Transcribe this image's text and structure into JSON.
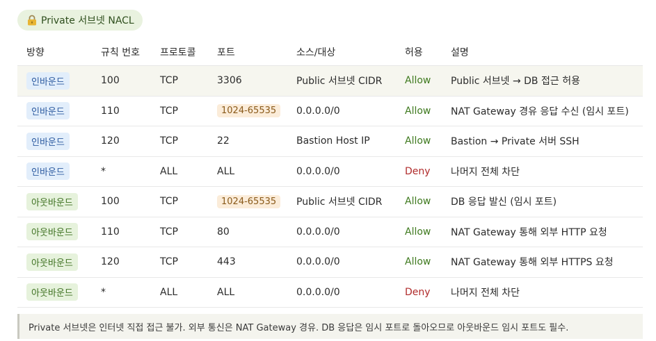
{
  "title": "Private 서브넷 NACL",
  "columns": [
    "방향",
    "규칙 번호",
    "프로토콜",
    "포트",
    "소스/대상",
    "허용",
    "설명"
  ],
  "rows": [
    {
      "dir": "인바운드",
      "dir_type": "in",
      "rule": "100",
      "proto": "TCP",
      "port": "3306",
      "port_pill": false,
      "source": "Public 서브넷 CIDR",
      "action": "Allow",
      "desc": "Public 서브넷 → DB 접근 허용"
    },
    {
      "dir": "인바운드",
      "dir_type": "in",
      "rule": "110",
      "proto": "TCP",
      "port": "1024-65535",
      "port_pill": true,
      "source": "0.0.0.0/0",
      "action": "Allow",
      "desc": "NAT Gateway 경유 응답 수신 (임시 포트)"
    },
    {
      "dir": "인바운드",
      "dir_type": "in",
      "rule": "120",
      "proto": "TCP",
      "port": "22",
      "port_pill": false,
      "source": "Bastion Host IP",
      "action": "Allow",
      "desc": "Bastion → Private 서버 SSH"
    },
    {
      "dir": "인바운드",
      "dir_type": "in",
      "rule": "*",
      "proto": "ALL",
      "port": "ALL",
      "port_pill": false,
      "source": "0.0.0.0/0",
      "action": "Deny",
      "desc": "나머지 전체 차단"
    },
    {
      "dir": "아웃바운드",
      "dir_type": "out",
      "rule": "100",
      "proto": "TCP",
      "port": "1024-65535",
      "port_pill": true,
      "source": "Public 서브넷 CIDR",
      "action": "Allow",
      "desc": "DB 응답 발신 (임시 포트)"
    },
    {
      "dir": "아웃바운드",
      "dir_type": "out",
      "rule": "110",
      "proto": "TCP",
      "port": "80",
      "port_pill": false,
      "source": "0.0.0.0/0",
      "action": "Allow",
      "desc": "NAT Gateway 통해 외부 HTTP 요청"
    },
    {
      "dir": "아웃바운드",
      "dir_type": "out",
      "rule": "120",
      "proto": "TCP",
      "port": "443",
      "port_pill": false,
      "source": "0.0.0.0/0",
      "action": "Allow",
      "desc": "NAT Gateway 통해 외부 HTTPS 요청"
    },
    {
      "dir": "아웃바운드",
      "dir_type": "out",
      "rule": "*",
      "proto": "ALL",
      "port": "ALL",
      "port_pill": false,
      "source": "0.0.0.0/0",
      "action": "Deny",
      "desc": "나머지 전체 차단"
    }
  ],
  "note": "Private 서브넷은 인터넷 직접 접근 불가. 외부 통신은 NAT Gateway 경유. DB 응답은 임시 포트로 돌아오므로 아웃바운드 임시 포트도 필수.",
  "colors": {
    "allow": "#3f7a1f",
    "deny": "#b02b2b",
    "inbound_bg": "#e2eefb",
    "outbound_bg": "#e6f2dc"
  }
}
